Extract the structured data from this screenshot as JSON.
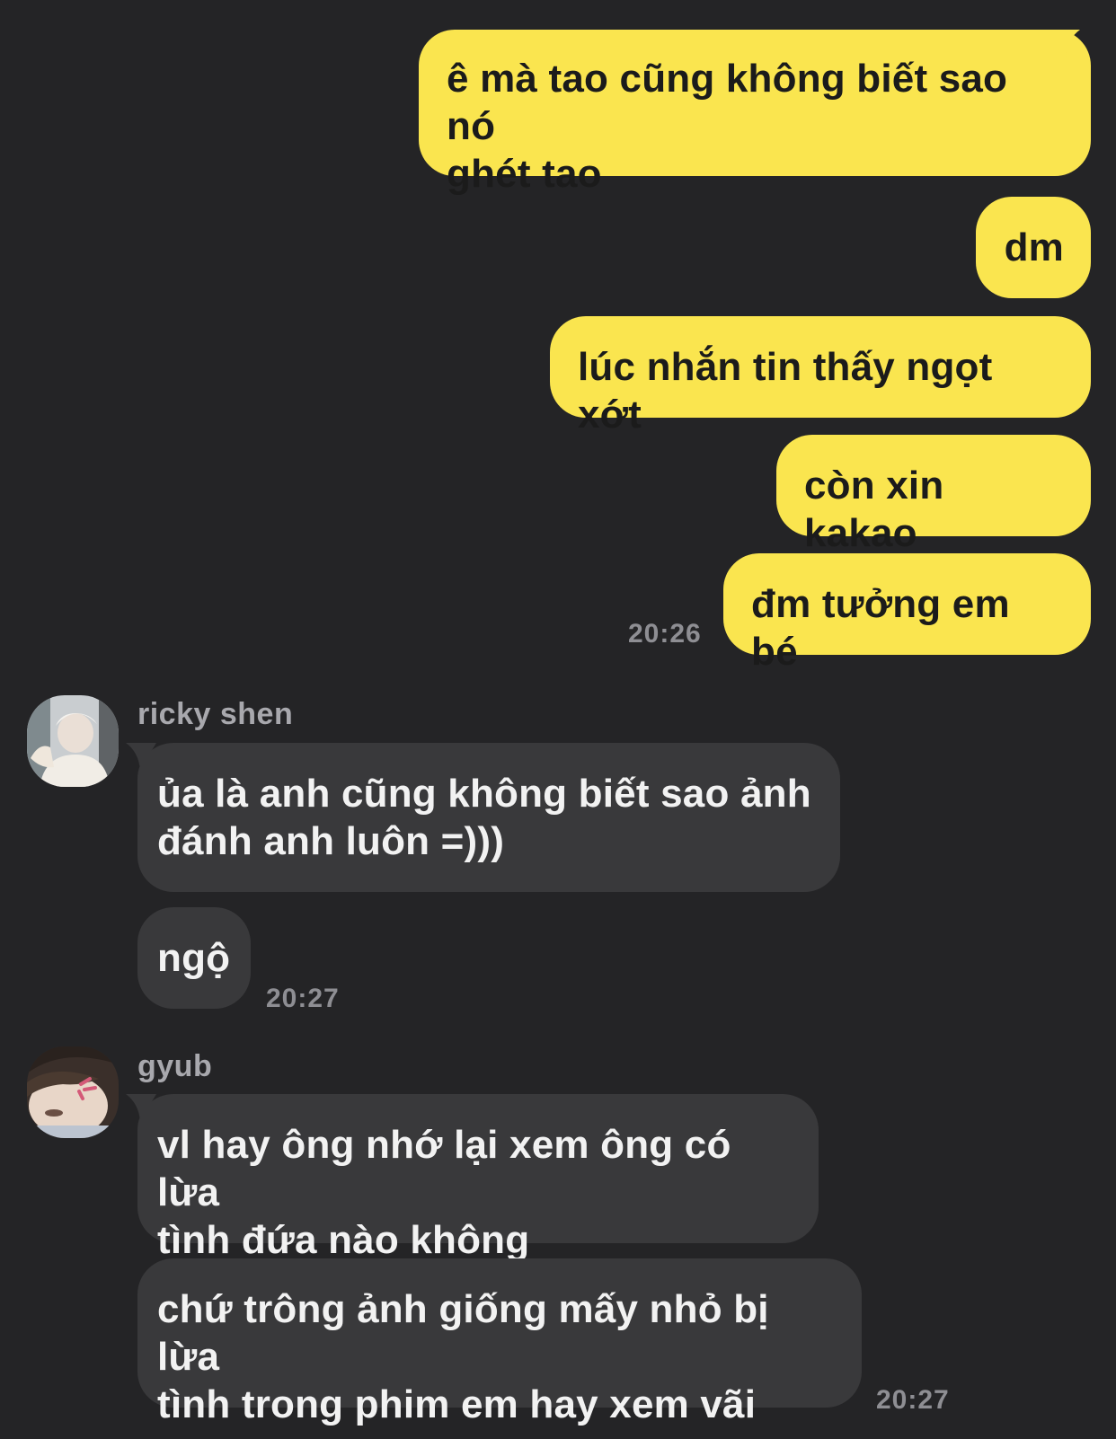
{
  "conversation": {
    "outgoing": [
      {
        "text": "ê mà tao cũng không biết sao nó\nghét tao"
      },
      {
        "text": "dm"
      },
      {
        "text": "lúc nhắn tin thấy ngọt xớt"
      },
      {
        "text": "còn xin kakao"
      },
      {
        "text": "đm tưởng em bé"
      }
    ],
    "outgoing_time": "20:26",
    "groups": [
      {
        "sender": "ricky shen",
        "avatar_icon": "avatar-photo-icon",
        "messages": [
          {
            "text": "ủa là anh cũng không biết sao ảnh\nđánh anh luôn =)))"
          },
          {
            "text": "ngộ"
          }
        ],
        "time": "20:27"
      },
      {
        "sender": "gyub",
        "avatar_icon": "avatar-photo-icon",
        "messages": [
          {
            "text": "vl hay ông nhớ lại xem ông có lừa\ntình đứa nào không"
          },
          {
            "text": "chứ trông ảnh giống mấy nhỏ bị lừa\ntình trong phim em hay xem vãi"
          }
        ],
        "time": "20:27"
      }
    ]
  },
  "colors": {
    "background": "#242426",
    "outgoing_bubble": "#fae54f",
    "incoming_bubble": "#39393b",
    "timestamp": "#8e8e93"
  }
}
